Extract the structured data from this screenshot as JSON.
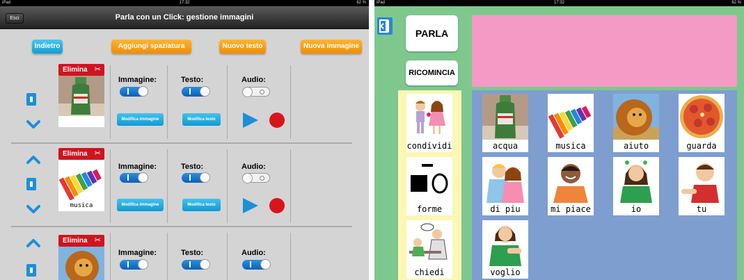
{
  "left_screen": {
    "status": {
      "device": "iPad",
      "time": "17:32",
      "battery": "62 %"
    },
    "nav": {
      "back_label": "Esci",
      "title": "Parla con un Click: gestione immagini"
    },
    "toolbar": {
      "back": "Indietro",
      "add_spacing": "Aggiungi spaziatura",
      "new_text": "Nuovo testo",
      "new_image": "Nuova immagine"
    },
    "rows": [
      {
        "delete": "Elimina",
        "caption": "",
        "image": "water-bottle",
        "image_label": "Immagine:",
        "text_label": "Testo:",
        "audio_label": "Audio:",
        "image_on": true,
        "text_on": true,
        "audio_on": false,
        "edit_image": "Modifica immagine",
        "edit_text": "Modifica testo"
      },
      {
        "delete": "Elimina",
        "caption": "musica",
        "image": "xylophone",
        "image_label": "Immagine:",
        "text_label": "Testo:",
        "audio_label": "Audio:",
        "image_on": true,
        "text_on": true,
        "audio_on": false,
        "edit_image": "Modifica immagine",
        "edit_text": "Modifica testo"
      },
      {
        "delete": "Elimina",
        "caption": "",
        "image": "lion",
        "image_label": "Immagine:",
        "text_label": "Testo:",
        "audio_label": "Audio:",
        "image_on": true,
        "text_on": true,
        "audio_on": true
      }
    ],
    "colors": {
      "toolbar_blue": "#1fa8de",
      "toolbar_orange": "#f7a010",
      "delete_red": "#cf1420",
      "record_red": "#d8151b"
    }
  },
  "right_screen": {
    "status": {
      "device": "iPad",
      "time": "17:32",
      "battery": "62 %"
    },
    "speak_button": "PARLA",
    "restart_button": "RICOMINCIA",
    "categories": [
      {
        "label": "condividi",
        "icon": "two-children"
      },
      {
        "label": "forme",
        "icon": "shapes"
      },
      {
        "label": "chiedi",
        "icon": "teacher-and-child"
      }
    ],
    "grid": [
      {
        "label": "acqua",
        "icon": "water-bottle"
      },
      {
        "label": "musica",
        "icon": "xylophone"
      },
      {
        "label": "aiuto",
        "icon": "lion"
      },
      {
        "label": "guarda",
        "icon": "pizza"
      },
      {
        "label": "di piu",
        "icon": "hugging-kids"
      },
      {
        "label": "mi piace",
        "icon": "smiling-boy"
      },
      {
        "label": "io",
        "icon": "girl-pointing-self"
      },
      {
        "label": "tu",
        "icon": "boy-pointing"
      },
      {
        "label": "voglio",
        "icon": "girl-wanting"
      }
    ],
    "colors": {
      "background": "#7ec88e",
      "text_bar": "#f49ac4",
      "category_bg": "#fdf7b4",
      "grid_bg": "#7e9ed0",
      "exit_blue": "#2e86d6"
    }
  }
}
